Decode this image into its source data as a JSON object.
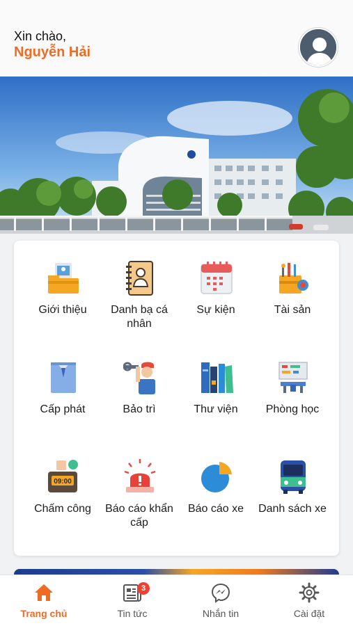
{
  "header": {
    "greeting": "Xin chào,",
    "user_name": "Nguyễn Hải"
  },
  "menu": [
    {
      "label": "Giới thiệu",
      "icon": "folder-id-icon"
    },
    {
      "label": "Danh bạ cá nhân",
      "icon": "address-book-icon"
    },
    {
      "label": "Sự kiện",
      "icon": "calendar-icon"
    },
    {
      "label": "Tài sản",
      "icon": "toolbox-icon"
    },
    {
      "label": "Cấp phát",
      "icon": "shirt-icon"
    },
    {
      "label": "Bảo trì",
      "icon": "repairman-icon"
    },
    {
      "label": "Thư viện",
      "icon": "books-icon"
    },
    {
      "label": "Phòng học",
      "icon": "classroom-icon"
    },
    {
      "label": "Chấm công",
      "icon": "time-clock-icon"
    },
    {
      "label": "Báo cáo khẩn cấp",
      "icon": "alarm-siren-icon"
    },
    {
      "label": "Báo cáo xe",
      "icon": "pie-chart-icon"
    },
    {
      "label": "Danh sách xe",
      "icon": "bus-icon"
    }
  ],
  "clock_text": "09:00",
  "bottom_nav": [
    {
      "label": "Trang chủ",
      "icon": "home-icon",
      "active": true
    },
    {
      "label": "Tin tức",
      "icon": "news-icon",
      "badge": "3"
    },
    {
      "label": "Nhắn tin",
      "icon": "messenger-icon"
    },
    {
      "label": "Cài đặt",
      "icon": "gear-icon"
    }
  ],
  "colors": {
    "accent": "#ef6b24",
    "badge": "#ea4335"
  }
}
